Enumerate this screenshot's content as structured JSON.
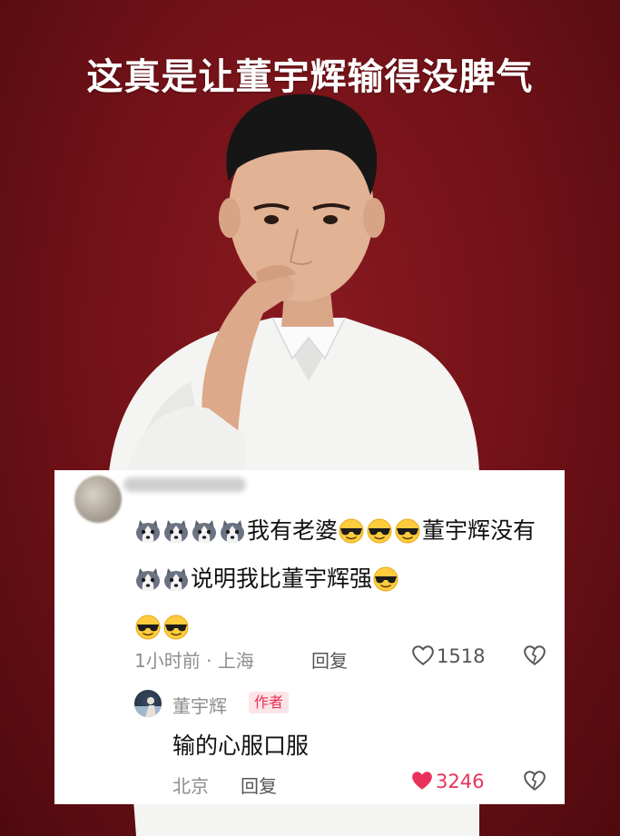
{
  "headline": "这真是让董宇辉输得没脾气",
  "colors": {
    "background": "#6e1117",
    "card": "#ffffff",
    "author_badge_bg": "#fde4e8",
    "author_badge_text": "#e8325a",
    "liked_heart": "#e8325a"
  },
  "comment": {
    "text_1": "我有老婆",
    "text_2": "董宇辉没有",
    "text_3": "说明我比董宇辉强",
    "time": "1小时前 · 上海",
    "reply_label": "回复",
    "likes": "1518",
    "emoji": [
      "husky-emoji",
      "sunglasses-emoji"
    ]
  },
  "reply": {
    "author": "董宇辉",
    "badge": "作者",
    "text": "输的心服口服",
    "location": "北京",
    "reply_label": "回复",
    "likes": "3246",
    "liked": true
  }
}
